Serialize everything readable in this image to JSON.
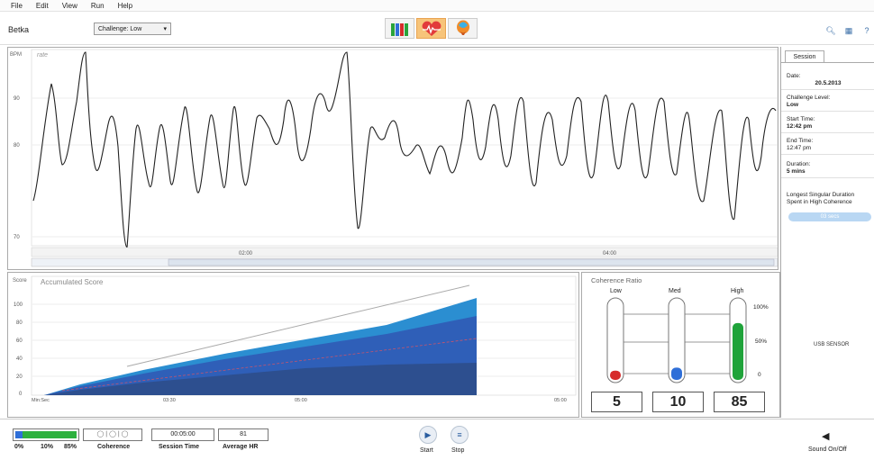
{
  "menu": [
    "File",
    "Edit",
    "View",
    "Run",
    "Help"
  ],
  "toolbar": {
    "user": "Betka",
    "challenge": "Challenge: Low",
    "modes": [
      "bars-chart-icon",
      "heart-hrv-icon",
      "balloon-icon"
    ]
  },
  "hrv_chart": {
    "ylabel": "BPM",
    "units": "rate",
    "y_ticks": [
      "90",
      "80",
      "70"
    ],
    "x_ticks": [
      "02:00",
      "04:00"
    ]
  },
  "score_chart": {
    "ylabel": "Score",
    "title": "Accumulated Score",
    "y_ticks": [
      "100",
      "80",
      "60",
      "40",
      "20",
      "0"
    ],
    "x_ticks": [
      "Min:Sec",
      "03:30",
      "05:00",
      "05:00"
    ]
  },
  "coherence": {
    "title": "Coherence Ratio",
    "labels": [
      "Low",
      "Med",
      "High"
    ],
    "pct_ticks": [
      "100%",
      "50%",
      "0"
    ],
    "values": [
      5,
      10,
      85
    ],
    "value_text": [
      "5",
      "10",
      "85"
    ],
    "colors": [
      "#d62b2b",
      "#2f6fd8",
      "#1fa33a"
    ]
  },
  "session": {
    "tab": "Session",
    "date_label": "Date:",
    "date": "20.5.2013",
    "challenge_label": "Challenge Level:",
    "challenge": "Low",
    "start_label": "Start Time:",
    "start": "12:42 pm",
    "end_label": "End Time:",
    "end": "12:47 pm",
    "duration_label": "Duration:",
    "duration": "5 mins",
    "longest_label": "Longest Singular Duration Spent in High Coherence",
    "longest": "03 secs",
    "sensor": "USB SENSOR"
  },
  "bottom": {
    "pcts": [
      "0%",
      "10%",
      "85%"
    ],
    "coherence_label": "Coherence",
    "session_time": "00:05:00",
    "session_time_label": "Session Time",
    "avg_hr": "81",
    "avg_hr_label": "Average HR",
    "start_label": "Start",
    "stop_label": "Stop",
    "sound_label": "Sound On/Off"
  }
}
